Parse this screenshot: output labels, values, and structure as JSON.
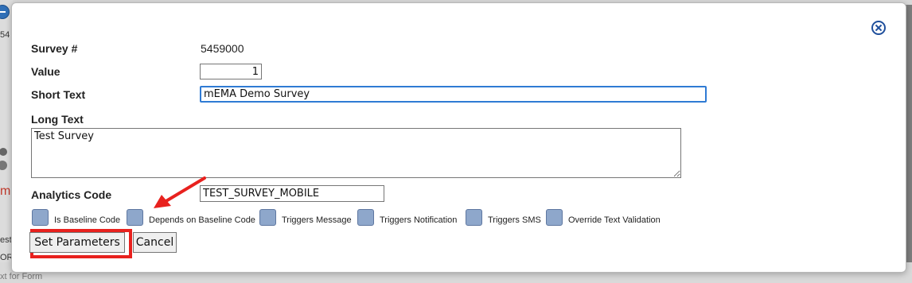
{
  "background": {
    "fragment_1": "54",
    "fragment_2": "est",
    "fragment_3": "ORI",
    "fragment_4": "xt for Form",
    "fragment_red": "m"
  },
  "form": {
    "survey_label": "Survey #",
    "survey_value": "5459000",
    "value_label": "Value",
    "value_input": "1",
    "short_text_label": "Short Text",
    "short_text_value": "mEMA Demo Survey",
    "long_text_label": "Long Text",
    "long_text_value": "Test Survey",
    "analytics_label": "Analytics Code",
    "analytics_value": "TEST_SURVEY_MOBILE"
  },
  "checkboxes": [
    {
      "label": "Is Baseline Code"
    },
    {
      "label": "Depends on Baseline Code"
    },
    {
      "label": "Triggers Message"
    },
    {
      "label": "Triggers Notification"
    },
    {
      "label": "Triggers SMS"
    },
    {
      "label": "Override Text Validation"
    }
  ],
  "buttons": {
    "set_parameters": "Set Parameters",
    "cancel": "Cancel"
  },
  "colors": {
    "accent": "#2f7bd4",
    "annotation": "#e8211e",
    "checkbox_fill": "#8ea7cb",
    "close_icon": "#1f4f9c"
  }
}
